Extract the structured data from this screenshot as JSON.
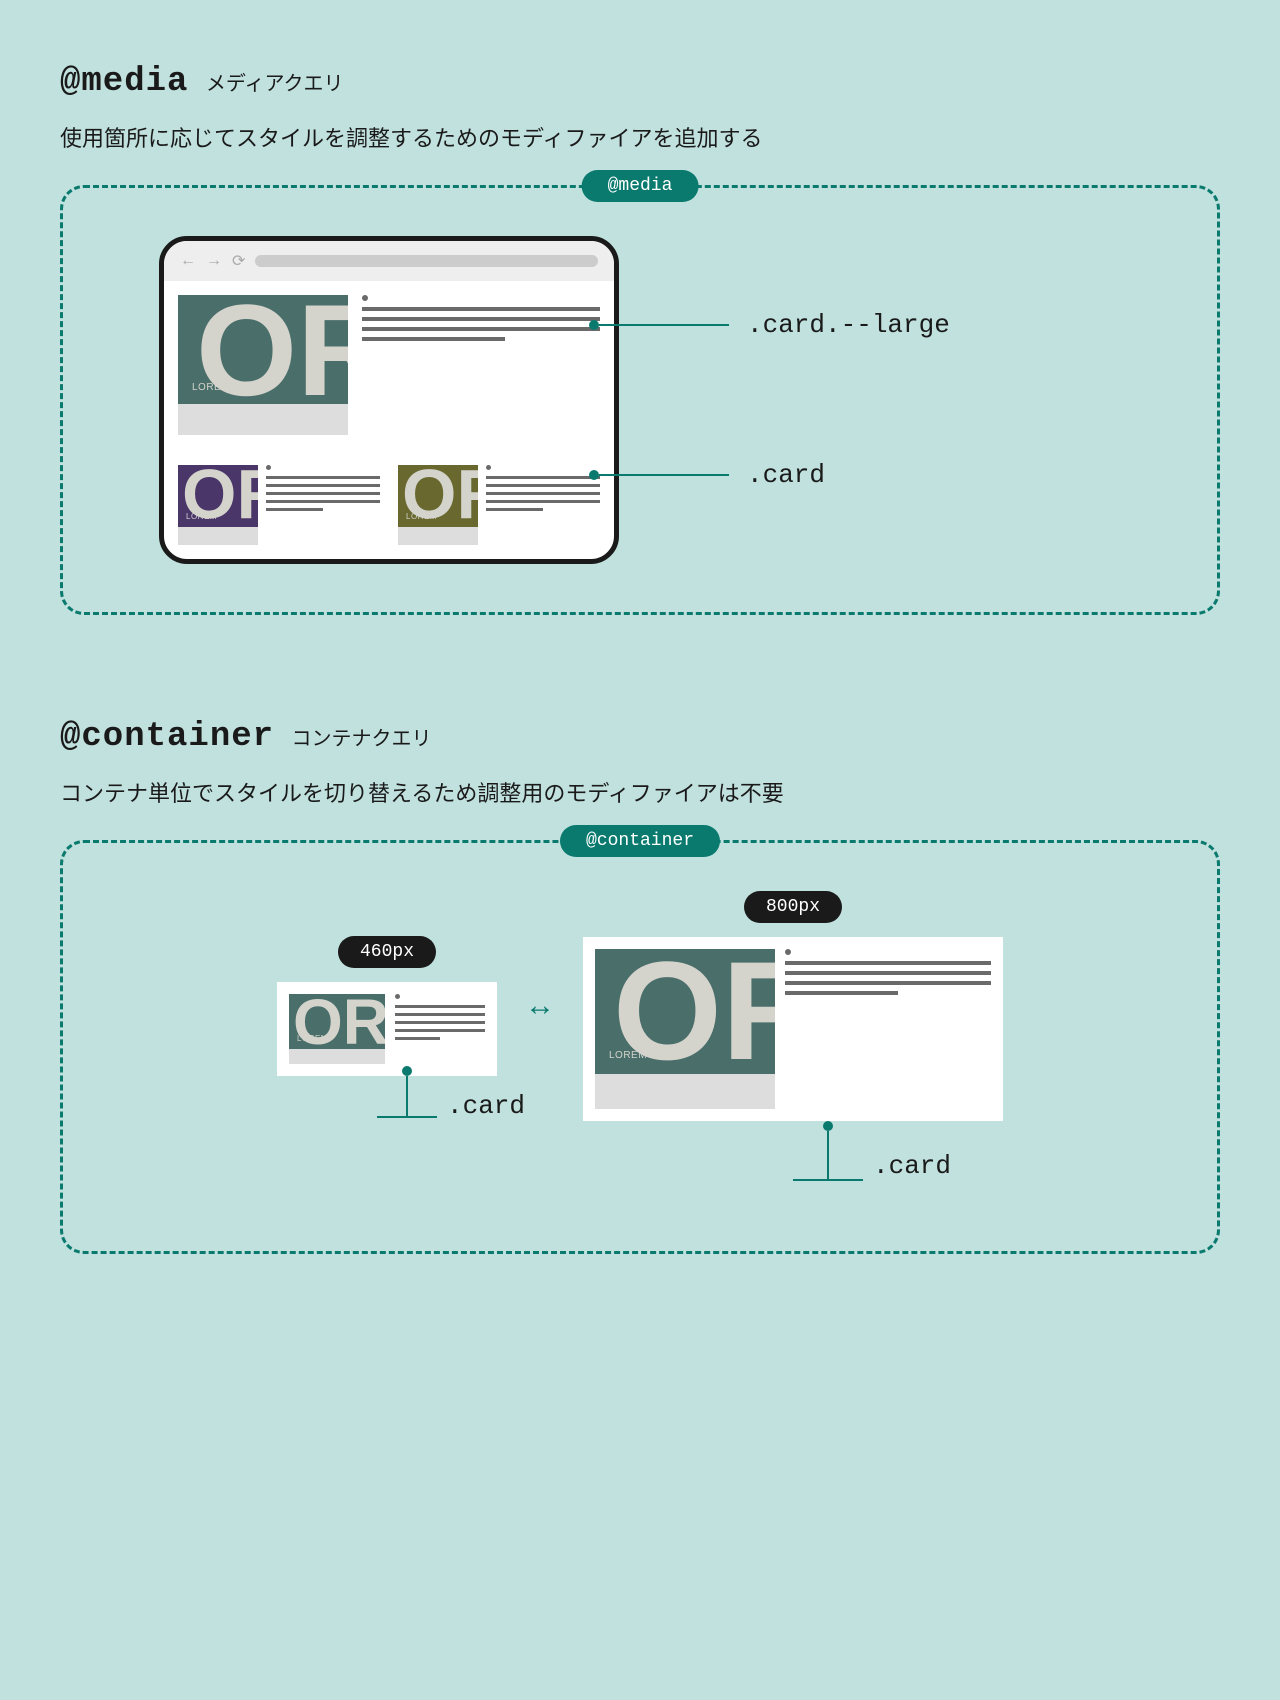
{
  "media": {
    "code": "@media",
    "sub": "メディアクエリ",
    "desc": "使用箇所に応じてスタイルを調整するためのモディファイアを追加する",
    "boxLabel": "@media",
    "ptr1": ".card.--large",
    "ptr2": ".card",
    "lorem": "LOREM"
  },
  "container": {
    "code": "@container",
    "sub": "コンテナクエリ",
    "desc": "コンテナ単位でスタイルを切り替えるため調整用のモディファイアは不要",
    "boxLabel": "@container",
    "size1": "460px",
    "size2": "800px",
    "lbl": ".card"
  }
}
